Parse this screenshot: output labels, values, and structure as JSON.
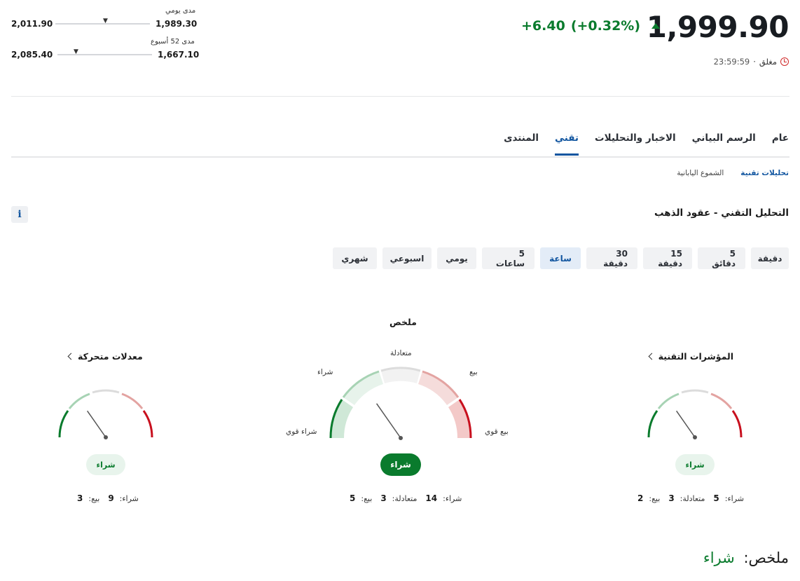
{
  "quote": {
    "price": "1,999.90",
    "change": "+6.40",
    "change_pct": "(+0.32%)",
    "status": "مغلق",
    "separator": "·",
    "time": "23:59:59"
  },
  "ranges": {
    "daily_label": "مدى يومي",
    "daily_low": "1,989.30",
    "daily_high": "2,011.90",
    "daily_position": 0.46,
    "week52_label": "مدى 52 أسبوع",
    "week52_low": "1,667.10",
    "week52_high": "2,085.40",
    "week52_position": 0.8
  },
  "tabs": [
    {
      "label": "عام",
      "active": false
    },
    {
      "label": "الرسم البياني",
      "active": false
    },
    {
      "label": "الاخبار والتحليلات",
      "active": false
    },
    {
      "label": "تقني",
      "active": true
    },
    {
      "label": "المنتدى",
      "active": false
    }
  ],
  "subtabs": [
    {
      "label": "تحليلات تقنية",
      "active": true
    },
    {
      "label": "الشموع اليابانية",
      "active": false
    }
  ],
  "section": {
    "title": "التحليل التقني - عقود الذهب",
    "info_icon": "i"
  },
  "periods": [
    {
      "label": "دقيقة",
      "active": false
    },
    {
      "label": "5 دقائق",
      "active": false
    },
    {
      "label": "15 دقيقة",
      "active": false
    },
    {
      "label": "30 دقيقة",
      "active": false
    },
    {
      "label": "ساعة",
      "active": true
    },
    {
      "label": "5 ساعات",
      "active": false
    },
    {
      "label": "يومي",
      "active": false
    },
    {
      "label": "اسبوعي",
      "active": false
    },
    {
      "label": "شهري",
      "active": false
    }
  ],
  "gauges": {
    "summary_title": "ملخص",
    "labels": {
      "neutral": "متعادلة",
      "buy": "شراء",
      "sell": "بيع",
      "strong_buy": "شراء قوي",
      "strong_sell": "بيع قوي"
    },
    "technical": {
      "title": "المؤشرات التقنية",
      "signal": "شراء",
      "buy_label": "شراء:",
      "buy": "5",
      "neutral_label": "متعادلة:",
      "neutral": "3",
      "sell_label": "بيع:",
      "sell": "2",
      "needle_deg": -35
    },
    "summary": {
      "signal": "شراء",
      "buy_label": "شراء:",
      "buy": "14",
      "neutral_label": "متعادلة:",
      "neutral": "3",
      "sell_label": "بيع:",
      "sell": "5",
      "needle_deg": -35
    },
    "moving_averages": {
      "title": "معدلات متحركة",
      "signal": "شراء",
      "buy_label": "شراء:",
      "buy": "9",
      "sell_label": "بيع:",
      "sell": "3",
      "needle_deg": -35
    }
  },
  "bottom_summary": {
    "label": "ملخص:",
    "value": "شراء"
  },
  "colors": {
    "accent": "#1256a0",
    "buy": "#0a7b2d",
    "sell": "#d02a2a"
  }
}
